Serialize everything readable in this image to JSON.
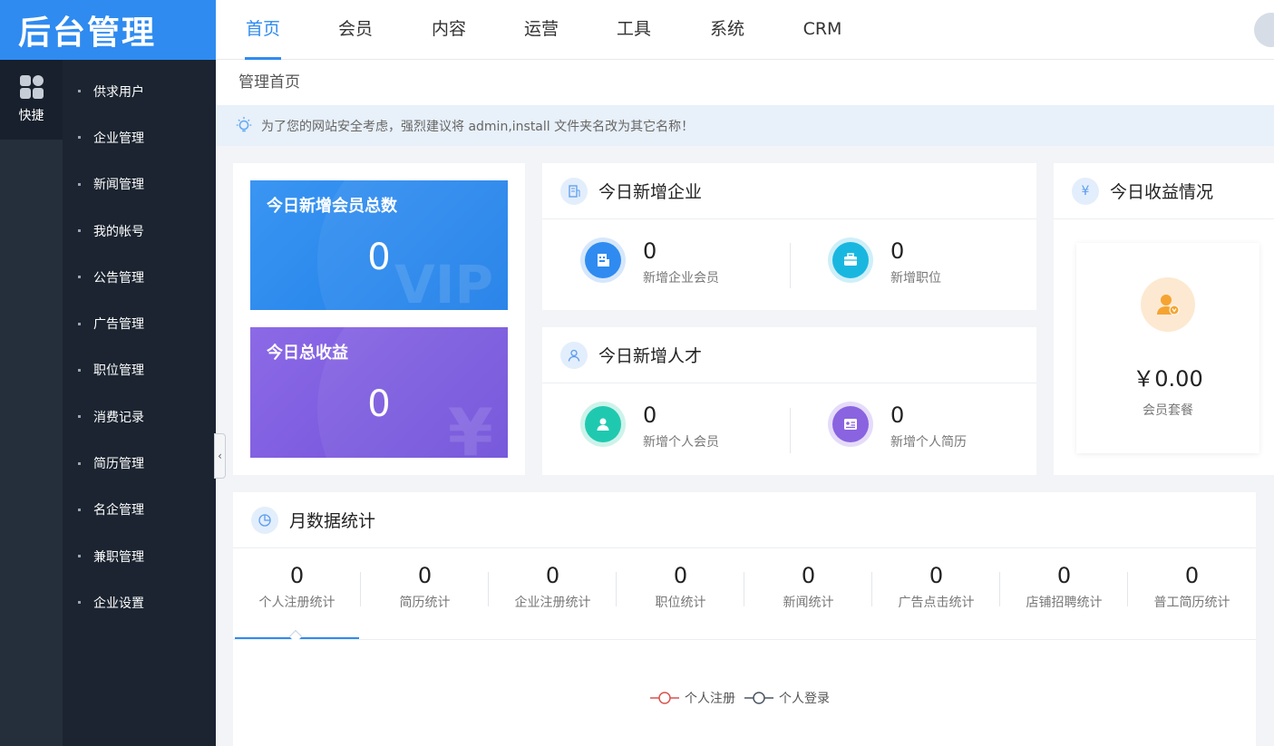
{
  "app": {
    "title": "后台管理"
  },
  "topnav": {
    "items": [
      "首页",
      "会员",
      "内容",
      "运营",
      "工具",
      "系统",
      "CRM"
    ],
    "active_index": 0
  },
  "rail": {
    "quick_label": "快捷"
  },
  "sidebar": {
    "items": [
      "供求用户",
      "企业管理",
      "新闻管理",
      "我的帐号",
      "公告管理",
      "广告管理",
      "职位管理",
      "消费记录",
      "简历管理",
      "名企管理",
      "兼职管理",
      "企业设置"
    ]
  },
  "breadcrumb": "管理首页",
  "notice": "为了您的网站安全考虑，强烈建议将 admin,install 文件夹名改为其它名称！",
  "tiles": {
    "members": {
      "title": "今日新增会员总数",
      "value": "0",
      "mark": "VIP"
    },
    "income": {
      "title": "今日总收益",
      "value": "0",
      "mark": "¥"
    }
  },
  "enterprise": {
    "title": "今日新增企业",
    "stats": [
      {
        "value": "0",
        "caption": "新增企业会员"
      },
      {
        "value": "0",
        "caption": "新增职位"
      }
    ]
  },
  "talent": {
    "title": "今日新增人才",
    "stats": [
      {
        "value": "0",
        "caption": "新增个人会员"
      },
      {
        "value": "0",
        "caption": "新增个人简历"
      }
    ]
  },
  "revenue": {
    "title": "今日收益情况",
    "amount": "￥0.00",
    "caption": "会员套餐"
  },
  "monthly": {
    "title": "月数据统计",
    "stats": [
      {
        "value": "0",
        "caption": "个人注册统计"
      },
      {
        "value": "0",
        "caption": "简历统计"
      },
      {
        "value": "0",
        "caption": "企业注册统计"
      },
      {
        "value": "0",
        "caption": "职位统计"
      },
      {
        "value": "0",
        "caption": "新闻统计"
      },
      {
        "value": "0",
        "caption": "广告点击统计"
      },
      {
        "value": "0",
        "caption": "店铺招聘统计"
      },
      {
        "value": "0",
        "caption": "普工简历统计"
      }
    ],
    "active_index": 0,
    "legend": [
      {
        "name": "个人注册",
        "color": "#d9534f"
      },
      {
        "name": "个人登录",
        "color": "#4a5563"
      }
    ]
  },
  "colors": {
    "primary": "#2f8bf0",
    "purple": "#7d5ce0",
    "sidebar": "#1b2430"
  }
}
